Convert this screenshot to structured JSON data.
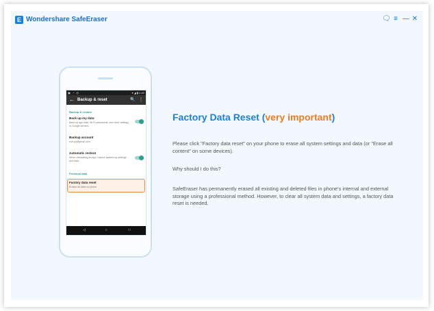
{
  "app": {
    "logo_letter": "E",
    "title": "Wondershare SafeEraser",
    "controls": {
      "feedback": "🗨",
      "menu": "≡",
      "minimize": "—",
      "close": "✕"
    }
  },
  "phone": {
    "status_left": "▣ ◔ ◎",
    "status_right": "▾ ◢ ▮ 4:40",
    "actionbar": {
      "back": "←",
      "title": "Backup & reset",
      "search": "🔍",
      "more": "⋮"
    },
    "sections": [
      {
        "header": "Backup & restore",
        "items": [
          {
            "title": "Back up my data",
            "subtitle": "Back up app data, Wi-Fi passwords, and other settings to Google servers",
            "toggle": true
          },
          {
            "title": "Backup account",
            "subtitle": "cnit.qu@gmail.com",
            "toggle": false
          },
          {
            "title": "Automatic restore",
            "subtitle": "When reinstalling an app, restore backed up settings and data",
            "toggle": true
          }
        ]
      },
      {
        "header": "Personal data",
        "items": [
          {
            "title": "Factory data reset",
            "subtitle": "Erases all data on phone",
            "toggle": false,
            "highlighted": true
          }
        ]
      }
    ],
    "navbar": {
      "back": "◁",
      "home": "○",
      "recent": "□"
    }
  },
  "content": {
    "heading_main": "Factory Data Reset (",
    "heading_highlight": "very important",
    "heading_end": ")",
    "paragraph1": "Please click \"Factory data reset\" on your phone to erase all system settings and data (or \"Erase all content\" on some devices).",
    "paragraph2": "Why should I do this?",
    "paragraph3": "SafeEraser has permanently erased all existing and deleted files in phone's internal and external storage using a professional method. However, to clear all system data and settings, a factory data reset is needed."
  },
  "colors": {
    "accent": "#1a7fe0",
    "highlight": "#f07c1f",
    "toggle": "#2a9d8f",
    "window_bg": "#f2f8fe"
  }
}
